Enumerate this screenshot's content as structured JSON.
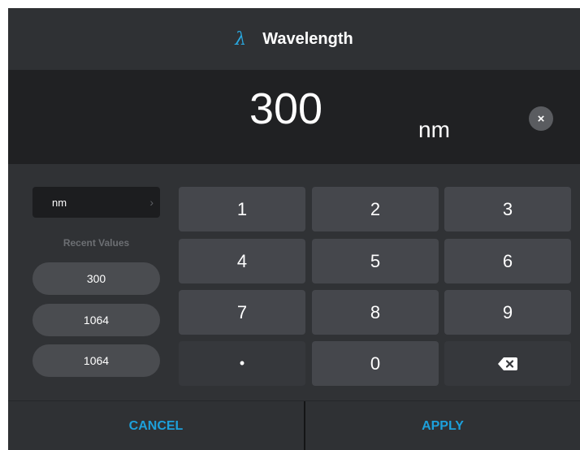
{
  "dialog": {
    "title_icon": "λ",
    "title": "Wavelength"
  },
  "display": {
    "value": "300",
    "unit": "nm",
    "clear_icon": "×"
  },
  "unit_select": {
    "value": "nm",
    "chevron": "›"
  },
  "recent": {
    "label": "Recent Values",
    "items": [
      "300",
      "1064",
      "1064"
    ]
  },
  "keypad": {
    "keys": [
      "1",
      "2",
      "3",
      "4",
      "5",
      "6",
      "7",
      "8",
      "9",
      "•",
      "0"
    ],
    "backspace_icon": "backspace-icon"
  },
  "footer": {
    "cancel_label": "CANCEL",
    "apply_label": "APPLY"
  },
  "colors": {
    "accent": "#1da0db",
    "background": "#303235",
    "display_background": "#202123",
    "key_background": "#45474c"
  }
}
